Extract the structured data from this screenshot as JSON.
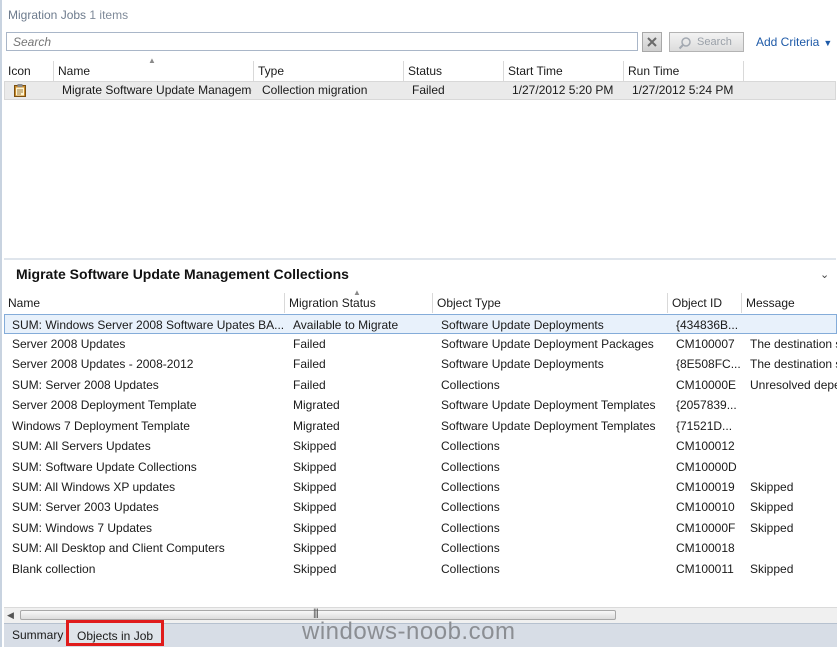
{
  "migration_jobs": {
    "title": "Migration Jobs",
    "count_text": "1 items",
    "search_placeholder": "Search",
    "search_button_label": "Search",
    "add_criteria_label": "Add Criteria",
    "columns": [
      "Icon",
      "Name",
      "Type",
      "Status",
      "Start Time",
      "Run Time"
    ],
    "rows": [
      {
        "name": "Migrate Software Update Manageme...",
        "type": "Collection migration",
        "status": "Failed",
        "start_time": "1/27/2012 5:20 PM",
        "run_time": "1/27/2012 5:24 PM"
      }
    ]
  },
  "details": {
    "title": "Migrate Software Update Management Collections",
    "columns": [
      "Name",
      "Migration Status",
      "Object Type",
      "Object ID",
      "Message"
    ],
    "rows": [
      {
        "name": "SUM: Windows Server 2008 Software Upates BA...",
        "status": "Available to Migrate",
        "object_type": "Software Update Deployments",
        "object_id": "{434836B...",
        "message": ""
      },
      {
        "name": "Server 2008 Updates",
        "status": "Failed",
        "object_type": "Software Update Deployment Packages",
        "object_id": "CM100007",
        "message": "The destination s"
      },
      {
        "name": "Server 2008 Updates - 2008-2012",
        "status": "Failed",
        "object_type": "Software Update Deployments",
        "object_id": "{8E508FC...",
        "message": "The destination s"
      },
      {
        "name": "SUM: Server 2008 Updates",
        "status": "Failed",
        "object_type": "Collections",
        "object_id": "CM10000E",
        "message": "Unresolved depe"
      },
      {
        "name": "Server 2008 Deployment Template",
        "status": "Migrated",
        "object_type": "Software Update Deployment Templates",
        "object_id": "{2057839...",
        "message": ""
      },
      {
        "name": "Windows 7 Deployment Template",
        "status": "Migrated",
        "object_type": "Software Update Deployment Templates",
        "object_id": "{71521D...",
        "message": ""
      },
      {
        "name": "SUM: All Servers Updates",
        "status": "Skipped",
        "object_type": "Collections",
        "object_id": "CM100012",
        "message": ""
      },
      {
        "name": "SUM: Software Update Collections",
        "status": "Skipped",
        "object_type": "Collections",
        "object_id": "CM10000D",
        "message": ""
      },
      {
        "name": "SUM: All Windows XP updates",
        "status": "Skipped",
        "object_type": "Collections",
        "object_id": "CM100019",
        "message": "Skipped"
      },
      {
        "name": "SUM: Server 2003 Updates",
        "status": "Skipped",
        "object_type": "Collections",
        "object_id": "CM100010",
        "message": "Skipped"
      },
      {
        "name": "SUM: Windows 7 Updates",
        "status": "Skipped",
        "object_type": "Collections",
        "object_id": "CM10000F",
        "message": "Skipped"
      },
      {
        "name": "SUM: All Desktop and Client Computers",
        "status": "Skipped",
        "object_type": "Collections",
        "object_id": "CM100018",
        "message": ""
      },
      {
        "name": "Blank collection",
        "status": "Skipped",
        "object_type": "Collections",
        "object_id": "CM100011",
        "message": "Skipped"
      }
    ]
  },
  "tabs": [
    "Summary",
    "Objects in Job"
  ],
  "watermark": "windows-noob.com",
  "colors": {
    "highlight_border": "#e01b1b",
    "selected_row_border": "#84acd9",
    "link": "#1e5aa8"
  }
}
